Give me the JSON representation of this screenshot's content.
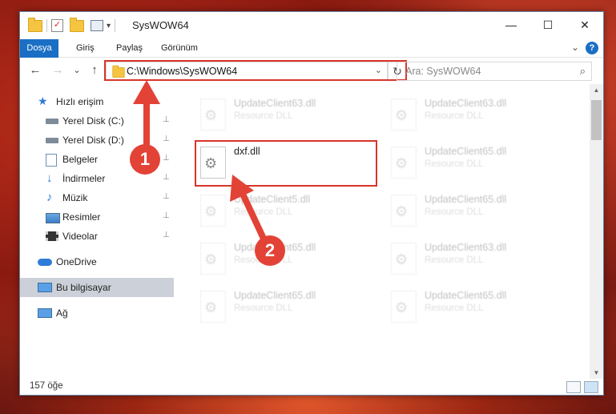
{
  "window": {
    "title": "SysWOW64",
    "controls": {
      "minimize": "—",
      "maximize": "☐",
      "close": "✕"
    }
  },
  "quick_access_toolbar": {
    "dropdown": "▾"
  },
  "ribbon": {
    "tabs": [
      {
        "label": "Dosya"
      },
      {
        "label": "Giriş"
      },
      {
        "label": "Paylaş"
      },
      {
        "label": "Görünüm"
      }
    ],
    "expand": "⌄",
    "help": "?"
  },
  "navigation": {
    "back": "←",
    "forward": "→",
    "recent": "⌄",
    "up": "↑",
    "address": "C:\\Windows\\SysWOW64",
    "address_dropdown": "⌄",
    "refresh": "↻",
    "search_placeholder": "Ara: SysWOW64",
    "search_icon": "⌕"
  },
  "sidebar": {
    "items": [
      {
        "label": "Hızlı erişim",
        "icon": "star-icon",
        "pinned": false
      },
      {
        "label": "Yerel Disk (C:)",
        "icon": "drive-icon",
        "pinned": true
      },
      {
        "label": "Yerel Disk (D:)",
        "icon": "drive-icon",
        "pinned": true
      },
      {
        "label": "Belgeler",
        "icon": "documents-icon",
        "pinned": true
      },
      {
        "label": "İndirmeler",
        "icon": "download-icon",
        "pinned": true
      },
      {
        "label": "Müzik",
        "icon": "music-icon",
        "pinned": true
      },
      {
        "label": "Resimler",
        "icon": "pictures-icon",
        "pinned": true
      },
      {
        "label": "Videolar",
        "icon": "videos-icon",
        "pinned": true
      },
      {
        "label": "OneDrive",
        "icon": "cloud-icon",
        "pinned": false
      },
      {
        "label": "Bu bilgisayar",
        "icon": "computer-icon",
        "pinned": false,
        "selected": true
      },
      {
        "label": "Ağ",
        "icon": "network-icon",
        "pinned": false
      }
    ],
    "pin_glyph": "📌"
  },
  "files": [
    {
      "name": "UpdateClient63.dll",
      "type": "Resource DLL",
      "faded": true
    },
    {
      "name": "UpdateClient63.dll",
      "type": "Resource DLL",
      "faded": true
    },
    {
      "name": "dxf.dll",
      "type": "",
      "faded": false,
      "highlighted": true
    },
    {
      "name": "UpdateClient65.dll",
      "type": "Resource DLL",
      "faded": true
    },
    {
      "name": "UpdateClient5.dll",
      "type": "Resource DLL",
      "faded": true
    },
    {
      "name": "UpdateClient65.dll",
      "type": "Resource DLL",
      "faded": true
    },
    {
      "name": "UpdateClient65.dll",
      "type": "Resource DLL",
      "faded": true
    },
    {
      "name": "UpdateClient63.dll",
      "type": "Resource DLL",
      "faded": true
    },
    {
      "name": "UpdateClient65.dll",
      "type": "Resource DLL",
      "faded": true
    },
    {
      "name": "UpdateClient65.dll",
      "type": "Resource DLL",
      "faded": true
    }
  ],
  "status": {
    "count": "157 öğe"
  },
  "annotations": {
    "callout_1": "1",
    "callout_2": "2",
    "color": "#e24336"
  }
}
